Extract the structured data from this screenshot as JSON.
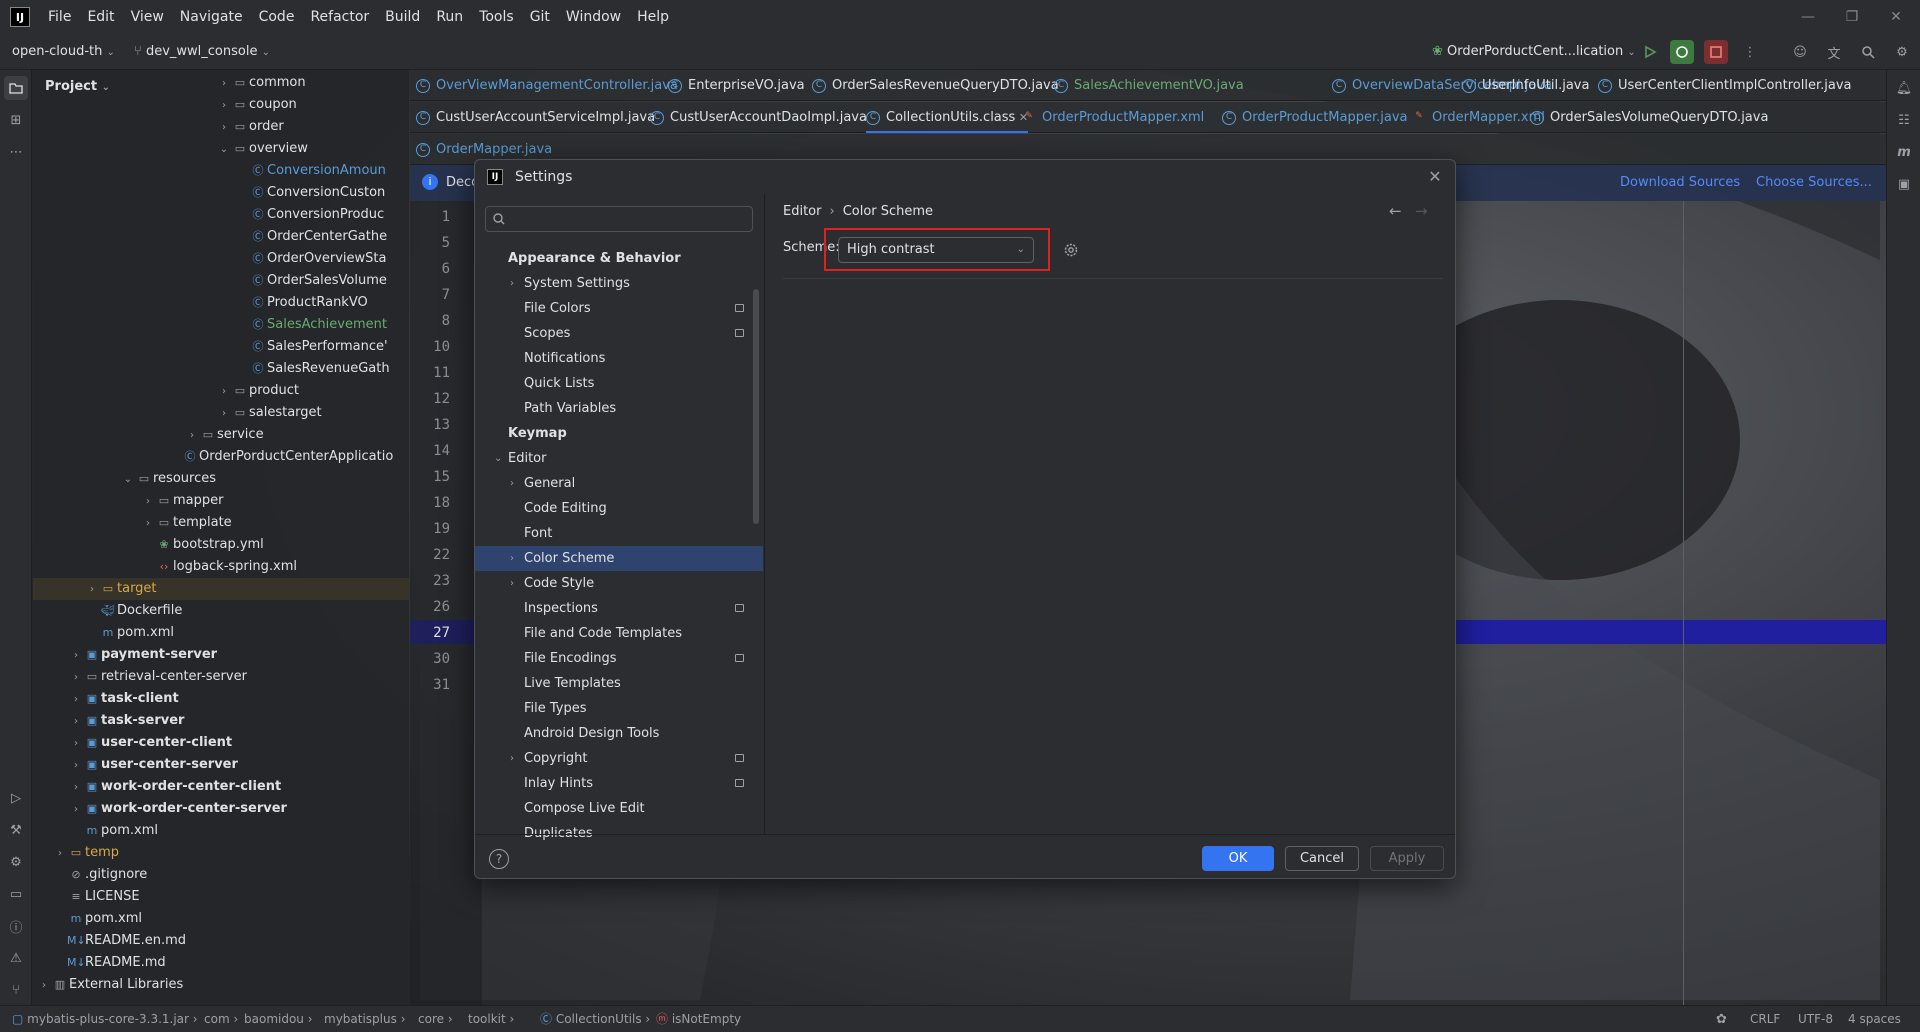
{
  "menubar": {
    "items": [
      "File",
      "Edit",
      "View",
      "Navigate",
      "Code",
      "Refactor",
      "Build",
      "Run",
      "Tools",
      "Git",
      "Window",
      "Help"
    ]
  },
  "toolbar": {
    "project_name": "open-cloud-th",
    "branch": "dev_wwl_console",
    "run_config": "OrderPorductCent...lication"
  },
  "project_panel": {
    "title": "Project",
    "tree": [
      {
        "label": "common",
        "icon": "folder-icon"
      },
      {
        "label": "coupon",
        "icon": "folder-icon"
      },
      {
        "label": "order",
        "icon": "folder-icon"
      },
      {
        "label": "overview",
        "icon": "folder-icon"
      },
      {
        "label": "ConversionAmoun",
        "icon": "class-icon"
      },
      {
        "label": "ConversionCuston",
        "icon": "class-icon"
      },
      {
        "label": "ConversionProduc",
        "icon": "class-icon"
      },
      {
        "label": "OrderCenterGathe",
        "icon": "class-icon"
      },
      {
        "label": "OrderOverviewSta",
        "icon": "class-icon"
      },
      {
        "label": "OrderSalesVolume",
        "icon": "class-icon"
      },
      {
        "label": "ProductRankVO",
        "icon": "class-icon"
      },
      {
        "label": "SalesAchievement",
        "icon": "class-icon"
      },
      {
        "label": "SalesPerformance'",
        "icon": "class-icon"
      },
      {
        "label": "SalesRevenueGath",
        "icon": "class-icon"
      },
      {
        "label": "product",
        "icon": "folder-icon"
      },
      {
        "label": "salestarget",
        "icon": "folder-icon"
      },
      {
        "label": "service",
        "icon": "folder-icon"
      },
      {
        "label": "OrderPorductCenterApplicatio",
        "icon": "class-icon"
      },
      {
        "label": "resources",
        "icon": "folder-icon"
      },
      {
        "label": "mapper",
        "icon": "folder-icon"
      },
      {
        "label": "template",
        "icon": "folder-icon"
      },
      {
        "label": "bootstrap.yml",
        "icon": "yml-icon"
      },
      {
        "label": "logback-spring.xml",
        "icon": "xml-icon"
      },
      {
        "label": "target",
        "icon": "folder-icon"
      },
      {
        "label": "Dockerfile",
        "icon": "docker-icon"
      },
      {
        "label": "pom.xml",
        "icon": "maven-icon"
      },
      {
        "label": "payment-server",
        "icon": "module-icon"
      },
      {
        "label": "retrieval-center-server",
        "icon": "folder-icon"
      },
      {
        "label": "task-client",
        "icon": "module-icon"
      },
      {
        "label": "task-server",
        "icon": "module-icon"
      },
      {
        "label": "user-center-client",
        "icon": "module-icon"
      },
      {
        "label": "user-center-server",
        "icon": "module-icon"
      },
      {
        "label": "work-order-center-client",
        "icon": "module-icon"
      },
      {
        "label": "work-order-center-server",
        "icon": "module-icon"
      },
      {
        "label": "pom.xml",
        "icon": "maven-icon"
      },
      {
        "label": "temp",
        "icon": "folder-icon"
      },
      {
        "label": ".gitignore",
        "icon": "ignore-icon"
      },
      {
        "label": "LICENSE",
        "icon": "text-icon"
      },
      {
        "label": "pom.xml",
        "icon": "maven-icon"
      },
      {
        "label": "README.en.md",
        "icon": "markdown-icon"
      },
      {
        "label": "README.md",
        "icon": "markdown-icon"
      },
      {
        "label": "External Libraries",
        "icon": "library-icon"
      }
    ]
  },
  "editor": {
    "tabs_row1": [
      "OverViewManagementController.java",
      "EnterpriseVO.java",
      "OrderSalesRevenueQueryDTO.java",
      "SalesAchievementVO.java",
      "OverviewDataServiceImpl.java",
      "UserInfoUtil.java",
      "UserCenterClientImplController.java"
    ],
    "tabs_row2": [
      "CustUserAccountServiceImpl.java",
      "CustUserAccountDaoImpl.java",
      "CollectionUtils.class",
      "OrderProductMapper.xml",
      "OrderProductMapper.java",
      "OrderMapper.xml",
      "OrderSalesVolumeQueryDTO.java"
    ],
    "tabs_row3": [
      "OrderMapper.java"
    ],
    "decompiled_prefix": "Deco",
    "download_sources": "Download Sources",
    "choose_sources": "Choose Sources...",
    "line_numbers": [
      "1",
      "5",
      "6",
      "7",
      "8",
      "10",
      "11",
      "12",
      "13",
      "14",
      "15",
      "18",
      "19",
      "22",
      "23",
      "26",
      "27",
      "30",
      "31"
    ]
  },
  "settings_dialog": {
    "title": "Settings",
    "nav": [
      {
        "label": "Appearance & Behavior",
        "level": 0,
        "bold": true,
        "chevron": false,
        "badge": false
      },
      {
        "label": "System Settings",
        "level": 1,
        "chevron": true,
        "badge": false
      },
      {
        "label": "File Colors",
        "level": 1,
        "chevron": false,
        "badge": true
      },
      {
        "label": "Scopes",
        "level": 1,
        "chevron": false,
        "badge": true
      },
      {
        "label": "Notifications",
        "level": 1,
        "chevron": false,
        "badge": false
      },
      {
        "label": "Quick Lists",
        "level": 1,
        "chevron": false,
        "badge": false
      },
      {
        "label": "Path Variables",
        "level": 1,
        "chevron": false,
        "badge": false
      },
      {
        "label": "Keymap",
        "level": 0,
        "bold": true,
        "chevron": false,
        "badge": false
      },
      {
        "label": "Editor",
        "level": 0,
        "bold": false,
        "chevron": true,
        "expanded": true,
        "badge": false
      },
      {
        "label": "General",
        "level": 1,
        "chevron": true,
        "badge": false
      },
      {
        "label": "Code Editing",
        "level": 1,
        "chevron": false,
        "badge": false
      },
      {
        "label": "Font",
        "level": 1,
        "chevron": false,
        "badge": false
      },
      {
        "label": "Color Scheme",
        "level": 1,
        "chevron": true,
        "badge": false,
        "selected": true
      },
      {
        "label": "Code Style",
        "level": 1,
        "chevron": true,
        "badge": false
      },
      {
        "label": "Inspections",
        "level": 1,
        "chevron": false,
        "badge": true
      },
      {
        "label": "File and Code Templates",
        "level": 1,
        "chevron": false,
        "badge": false
      },
      {
        "label": "File Encodings",
        "level": 1,
        "chevron": false,
        "badge": true
      },
      {
        "label": "Live Templates",
        "level": 1,
        "chevron": false,
        "badge": false
      },
      {
        "label": "File Types",
        "level": 1,
        "chevron": false,
        "badge": false
      },
      {
        "label": "Android Design Tools",
        "level": 1,
        "chevron": false,
        "badge": false
      },
      {
        "label": "Copyright",
        "level": 1,
        "chevron": true,
        "badge": true
      },
      {
        "label": "Inlay Hints",
        "level": 1,
        "chevron": false,
        "badge": true
      },
      {
        "label": "Compose Live Edit",
        "level": 1,
        "chevron": false,
        "badge": false
      },
      {
        "label": "Duplicates",
        "level": 1,
        "chevron": false,
        "badge": false
      }
    ],
    "breadcrumb": [
      "Editor",
      "Color Scheme"
    ],
    "scheme_label": "Scheme:",
    "scheme_value": "High contrast",
    "buttons": {
      "ok": "OK",
      "cancel": "Cancel",
      "apply": "Apply",
      "help": "?"
    }
  },
  "statusbar": {
    "path": [
      "mybatis-plus-core-3.3.1.jar",
      "com",
      "baomidou",
      "mybatisplus",
      "core",
      "toolkit",
      "CollectionUtils",
      "isNotEmpty"
    ],
    "line_ending": "CRLF",
    "encoding": "UTF-8",
    "indent": "4 spaces"
  },
  "colors": {
    "accent": "#3574f0",
    "highlight_box": "#e0221f",
    "selection": "#2e436e",
    "current_line": "#1f1fa0"
  }
}
